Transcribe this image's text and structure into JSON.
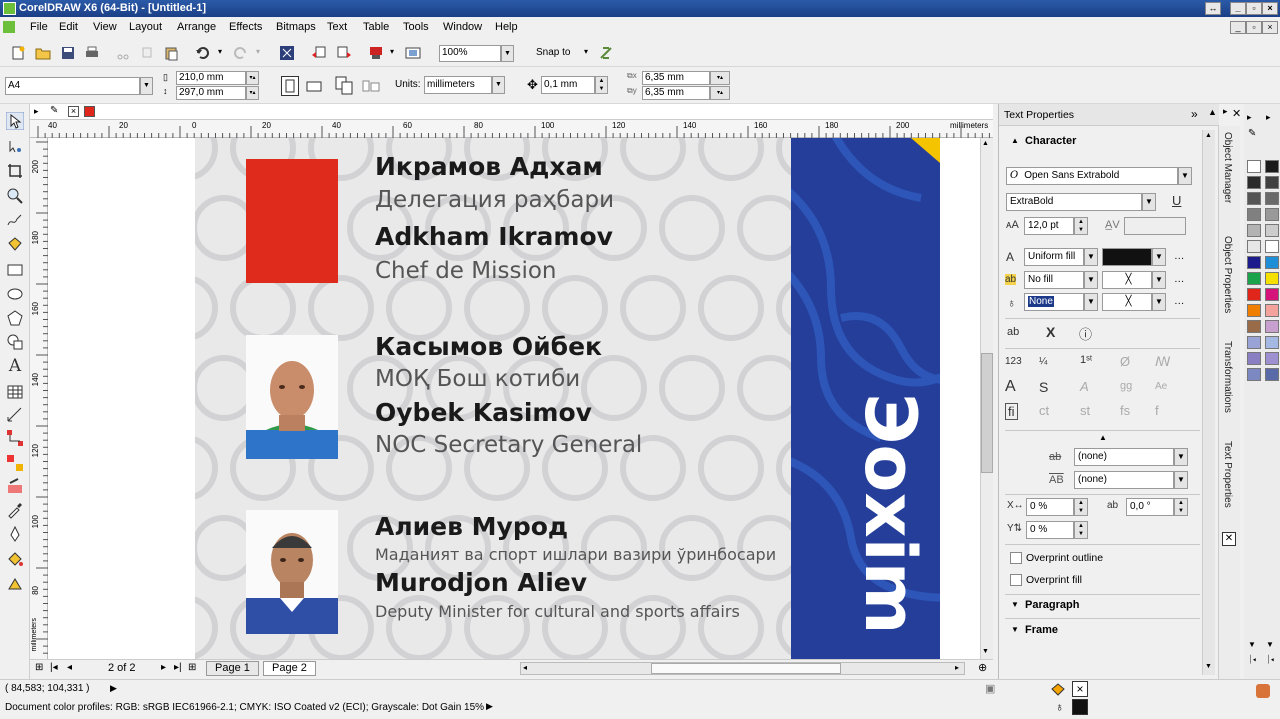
{
  "app": {
    "title": "CorelDRAW X6 (64-Bit) - [Untitled-1]"
  },
  "menu": [
    "File",
    "Edit",
    "View",
    "Layout",
    "Arrange",
    "Effects",
    "Bitmaps",
    "Text",
    "Table",
    "Tools",
    "Window",
    "Help"
  ],
  "standard_toolbar": {
    "zoom": "100%",
    "snap_to": "Snap to"
  },
  "property_bar": {
    "page_size": "A4",
    "width": "210,0 mm",
    "height": "297,0 mm",
    "units_label": "Units:",
    "units_value": "millimeters",
    "nudge": "0,1 mm",
    "dup_x": "6,35 mm",
    "dup_y": "6,35 mm"
  },
  "ruler": {
    "h_ticks": [
      "40",
      "20",
      "0",
      "20",
      "40",
      "60",
      "80",
      "100",
      "120",
      "140",
      "160",
      "180",
      "200"
    ],
    "h_unit": "millimeters",
    "v_ticks": [
      "200",
      "180",
      "160",
      "140",
      "120",
      "100",
      "80"
    ],
    "v_unit": "millimeters"
  },
  "document": {
    "people": [
      {
        "name_ru": "Икрамов Адхам",
        "role_ru": "Делегация раҳбари",
        "name_en": "Adkham Ikramov",
        "role_en": "Chef de Mission",
        "photo": "red-placeholder"
      },
      {
        "name_ru": "Касымов Ойбек",
        "role_ru": "МОҚ Бош котиби",
        "name_en": "Oybek Kasimov",
        "role_en": "NOC Secretary General",
        "photo": "portrait"
      },
      {
        "name_ru": "Алиев Мурод",
        "role_ru": "Маданият ва спорт ишлари вазири ўринбосари",
        "name_en": "Murodjon Aliev",
        "role_en": "Deputy Minister for cultural and sports affairs",
        "photo": "portrait"
      }
    ],
    "side_text": "Эоxim"
  },
  "pager": {
    "counter": "2 of 2",
    "tabs": [
      "Page 1",
      "Page 2"
    ]
  },
  "status": {
    "coords": "( 84,583; 104,331 )",
    "profiles": "Document color profiles: RGB: sRGB IEC61966-2.1; CMYK: ISO Coated v2 (ECI); Grayscale: Dot Gain 15%"
  },
  "docker": {
    "title": "Text Properties",
    "character_header": "Character",
    "font": "Open Sans Extrabold",
    "style": "ExtraBold",
    "size": "12,0 pt",
    "fill_type": "Uniform fill",
    "bg_fill": "No fill",
    "outline": "None",
    "strike": "(none)",
    "overline": "(none)",
    "kerning": "0 %",
    "angle": "0,0 °",
    "vshift": "0 %",
    "overprint_outline": "Overprint outline",
    "overprint_fill": "Overprint fill",
    "paragraph_header": "Paragraph",
    "frame_header": "Frame"
  },
  "side_tabs": [
    "Object Manager",
    "Object Properties",
    "Transformations",
    "Text Properties"
  ],
  "palette": [
    "#ffffff",
    "#1a1a1a",
    "#2b2b2b",
    "#404040",
    "#555555",
    "#6a6a6a",
    "#808080",
    "#999999",
    "#b3b3b3",
    "#cccccc",
    "#e6e6e6",
    "#ffffff",
    "#1c1c8c",
    "#1e8fd6",
    "#1aa34a",
    "#f5e000",
    "#e0261b",
    "#d6137b",
    "#f07f00",
    "#f3a29c",
    "#9a6b48",
    "#c7a0cf",
    "#9aa3d6",
    "#a4b8e3",
    "#8b7fc3",
    "#9d8fd0",
    "#7c88c2",
    "#5a6aa8"
  ]
}
